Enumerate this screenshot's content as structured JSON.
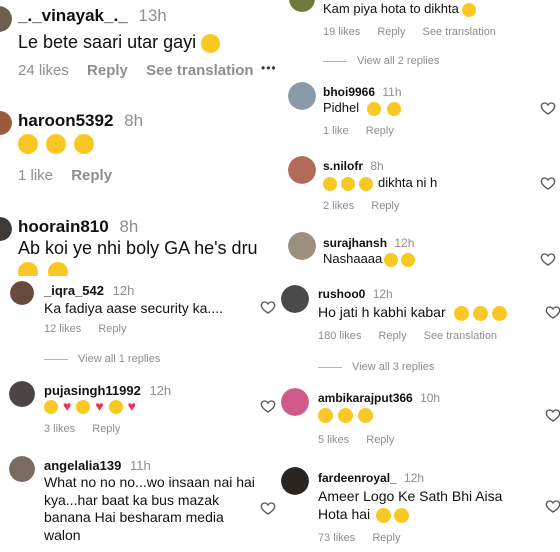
{
  "left": {
    "c1": {
      "user": "_._vinayak_._",
      "time": "13h",
      "text": "Le bete saari utar gayi",
      "likes": "24 likes",
      "reply": "Reply",
      "translate": "See translation",
      "more": "•••"
    },
    "c2": {
      "user": "haroon5392",
      "time": "8h",
      "likes": "1 like",
      "reply": "Reply"
    },
    "c3": {
      "user": "hoorain810",
      "time": "8h",
      "text": "Ab koi ye nhi boly GA he's dru"
    },
    "c4": {
      "user": "_iqra_542",
      "time": "12h",
      "text": "Ka fadiya aase security ka....",
      "likes": "12 likes",
      "reply": "Reply",
      "view_replies": "View all 1 replies"
    },
    "c5": {
      "user": "pujasingh11992",
      "time": "12h",
      "likes": "3 likes",
      "reply": "Reply"
    },
    "c6": {
      "user": "angelalia139",
      "time": "11h",
      "text1": "What no no no...wo insaan nai hai",
      "text2": "kya...har baat ka bus mazak",
      "text3": "banana Hai besharam media",
      "text4": "walon"
    }
  },
  "right": {
    "r0": {
      "text": "Kam piya hota to dikhta",
      "likes": "19 likes",
      "reply": "Reply",
      "translate": "See translation",
      "view_replies": "View all 2 replies"
    },
    "r1": {
      "user": "bhoi9966",
      "time": "11h",
      "text": "Pidhel",
      "likes": "1 like",
      "reply": "Reply"
    },
    "r2": {
      "user": "s.nilofr",
      "time": "8h",
      "text": "dikhta ni h",
      "likes": "2 likes",
      "reply": "Reply"
    },
    "r3": {
      "user": "surajhansh",
      "time": "12h",
      "text": "Nashaaaa"
    },
    "r4": {
      "user": "rushoo0",
      "time": "12h",
      "text": "Ho jati h kabhi kabar",
      "likes": "180 likes",
      "reply": "Reply",
      "translate": "See translation",
      "view_replies": "View all 3 replies"
    },
    "r5": {
      "user": "ambikarajput366",
      "time": "10h",
      "likes": "5 likes",
      "reply": "Reply"
    },
    "r6": {
      "user": "fardeenroyal_",
      "time": "12h",
      "text1": "Ameer Logo Ke Sath Bhi Aisa",
      "text2": "Hota hai",
      "likes": "73 likes",
      "reply": "Reply"
    }
  },
  "colors": {
    "muted": "#8e8e8e",
    "emoji": "#f9c825",
    "heart_pink": "#e8335a"
  }
}
